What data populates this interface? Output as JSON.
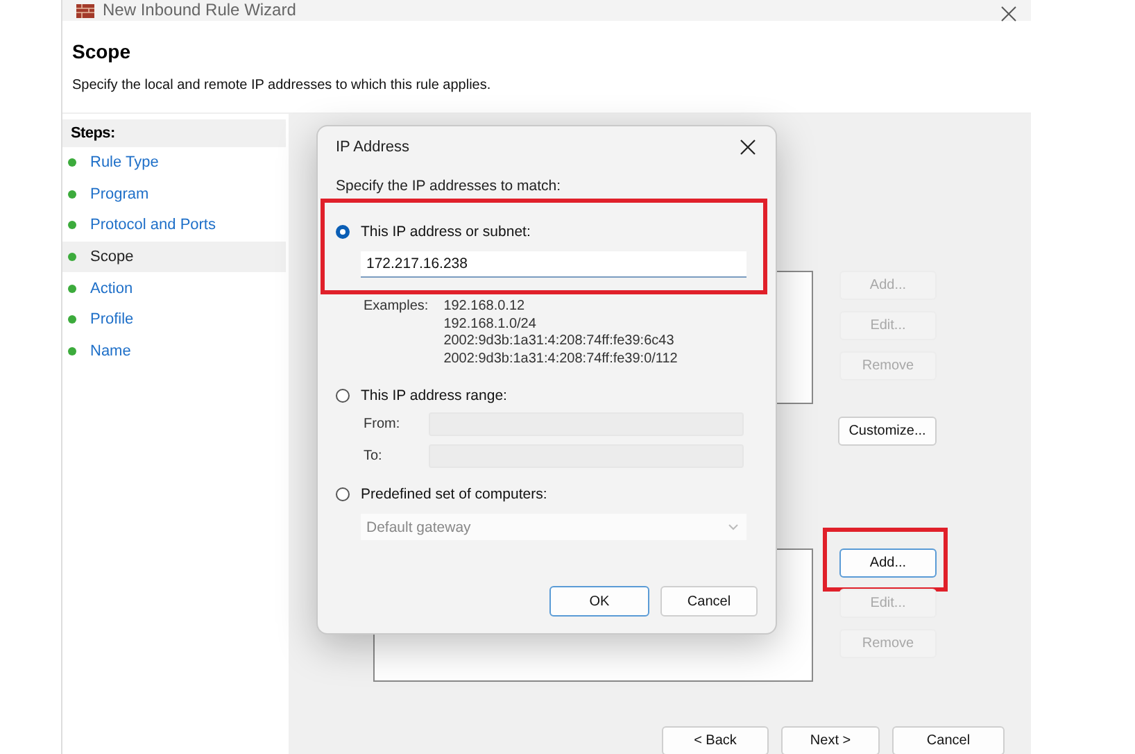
{
  "window": {
    "title": "New Inbound Rule Wizard"
  },
  "header": {
    "title": "Scope",
    "description": "Specify the local and remote IP addresses to which this rule applies."
  },
  "steps": {
    "heading": "Steps:",
    "items": [
      {
        "label": "Rule Type",
        "selected": false
      },
      {
        "label": "Program",
        "selected": false
      },
      {
        "label": "Protocol and Ports",
        "selected": false
      },
      {
        "label": "Scope",
        "selected": true
      },
      {
        "label": "Action",
        "selected": false
      },
      {
        "label": "Profile",
        "selected": false
      },
      {
        "label": "Name",
        "selected": false
      }
    ]
  },
  "groups": [
    {
      "buttons": [
        {
          "label": "Add...",
          "disabled": true,
          "highlighted": false
        },
        {
          "label": "Edit...",
          "disabled": true,
          "highlighted": false
        },
        {
          "label": "Remove",
          "disabled": true,
          "highlighted": false
        }
      ],
      "extra_button": "Customize..."
    },
    {
      "buttons": [
        {
          "label": "Add...",
          "disabled": false,
          "highlighted": true
        },
        {
          "label": "Edit...",
          "disabled": true,
          "highlighted": false
        },
        {
          "label": "Remove",
          "disabled": true,
          "highlighted": false
        }
      ]
    }
  ],
  "footer": {
    "buttons": [
      "< Back",
      "Next >",
      "Cancel"
    ]
  },
  "dialog": {
    "title": "IP Address",
    "prompt": "Specify the IP addresses to match:",
    "options": [
      {
        "kind": "subnet",
        "label": "This IP address or subnet:",
        "selected": true,
        "highlighted": true,
        "value": "172.217.16.238",
        "examples_label": "Examples:",
        "examples": [
          "192.168.0.12",
          "192.168.1.0/24",
          "2002:9d3b:1a31:4:208:74ff:fe39:6c43",
          "2002:9d3b:1a31:4:208:74ff:fe39:0/112"
        ]
      },
      {
        "kind": "range",
        "label": "This IP address range:",
        "selected": false,
        "highlighted": false,
        "from_label": "From:",
        "to_label": "To:"
      },
      {
        "kind": "predefined",
        "label": "Predefined set of computers:",
        "selected": false,
        "highlighted": false,
        "value": "Default gateway"
      }
    ],
    "buttons": [
      "OK",
      "Cancel"
    ]
  }
}
